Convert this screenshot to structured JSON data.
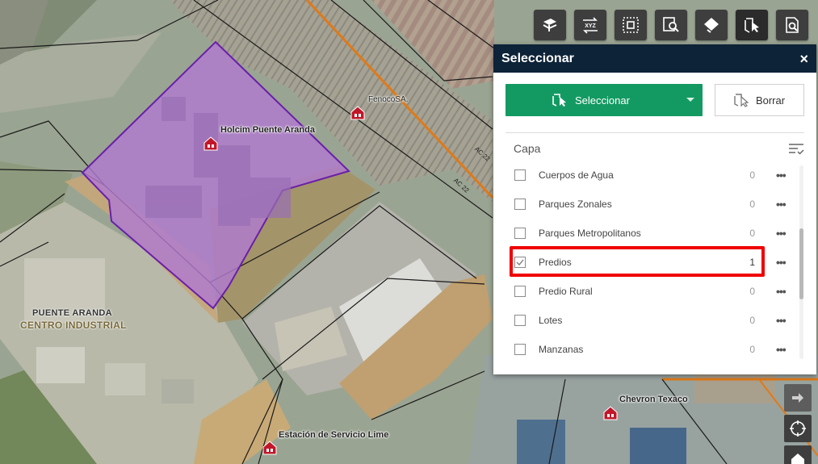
{
  "map": {
    "labels": {
      "holcim": "Holcim Puente Aranda",
      "fenoco": "FenocoSA.",
      "chevron": "Chevron Texaco",
      "estacion": "Estación de Servicio Lime",
      "district_line1": "PUENTE ARANDA",
      "district_line2": "CENTRO INDUSTRIAL",
      "road_1": "AC 22",
      "road_2": "AC 22"
    },
    "colors": {
      "selection_fill": "#b07ad0",
      "selection_stroke": "#6a1fa8",
      "road_orange": "#e07a18"
    }
  },
  "toolbar": {
    "buttons": [
      {
        "name": "layers-icon"
      },
      {
        "name": "xyz-coordinates-icon",
        "text": "XYZ"
      },
      {
        "name": "extent-icon"
      },
      {
        "name": "search-map-icon"
      },
      {
        "name": "eraser-icon"
      },
      {
        "name": "select-tool-icon"
      },
      {
        "name": "query-icon"
      }
    ]
  },
  "panel": {
    "title": "Seleccionar",
    "close": "×",
    "select_button": "Seleccionar",
    "clear_button": "Borrar",
    "layer_header": "Capa",
    "layers": [
      {
        "name": "Cuerpos de Agua",
        "count": "0",
        "checked": false
      },
      {
        "name": "Parques Zonales",
        "count": "0",
        "checked": false
      },
      {
        "name": "Parques Metropolitanos",
        "count": "0",
        "checked": false
      },
      {
        "name": "Predios",
        "count": "1",
        "checked": true
      },
      {
        "name": "Predio Rural",
        "count": "0",
        "checked": false
      },
      {
        "name": "Lotes",
        "count": "0",
        "checked": false
      },
      {
        "name": "Manzanas",
        "count": "0",
        "checked": false
      }
    ],
    "more_label": "•••",
    "accent": "#139a62",
    "header_bg": "#0d2337",
    "highlight_color": "#f00000"
  }
}
